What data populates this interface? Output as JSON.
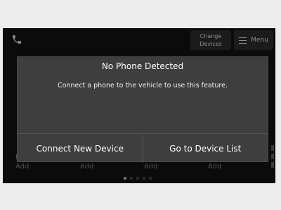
{
  "topbar": {
    "phone_icon": "phone-icon",
    "change_devices_label": "Change Devices",
    "menu_label": "Menu",
    "menu_icon": "hamburger-icon"
  },
  "dialog": {
    "title": "No Phone Detected",
    "message": "Connect a phone to the vehicle to use this feature.",
    "connect_button": "Connect New Device",
    "device_list_button": "Go to Device List"
  },
  "favorites": {
    "items": [
      {
        "icon": "plus-circle-icon",
        "label": "Press & Hold to Add"
      },
      {
        "icon": "plus-circle-icon",
        "label": "Press & Hold to Add"
      },
      {
        "icon": "plus-circle-icon",
        "label": "Press & Hold to Add"
      },
      {
        "icon": "plus-circle-icon",
        "label": "Press & Hold to Add"
      }
    ]
  },
  "pagination": {
    "pages": 5,
    "current": 1
  },
  "colors": {
    "screen_bg": "#0b0b0b",
    "dialog_bg": "#3e3e3e",
    "text_primary": "#ffffff",
    "text_dim": "#4e4e4e"
  }
}
